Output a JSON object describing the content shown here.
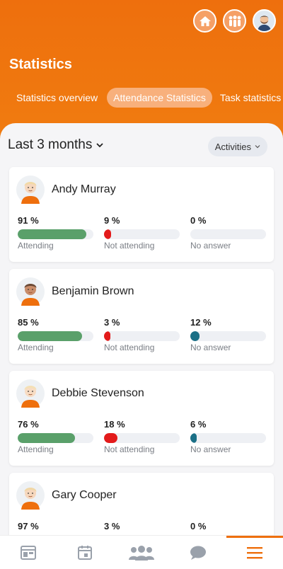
{
  "header": {
    "title": "Statistics",
    "icons": [
      "home-icon",
      "team-icon",
      "user-avatar"
    ]
  },
  "tabs": [
    {
      "label": "Statistics overview",
      "active": false
    },
    {
      "label": "Attendance Statistics",
      "active": true
    },
    {
      "label": "Task statistics",
      "active": false
    }
  ],
  "filters": {
    "period": "Last 3 months",
    "type": "Activities"
  },
  "labels": {
    "attending": "Attending",
    "not_attending": "Not attending",
    "no_answer": "No answer"
  },
  "colors": {
    "brand": "#ee6f0d",
    "attending": "#5aa06a",
    "not_attending": "#e31b1b",
    "no_answer": "#1b6f86"
  },
  "members": [
    {
      "name": "Andy Murray",
      "attending": "91 %",
      "not_attending": "9 %",
      "no_answer": "0 %",
      "values": [
        91,
        9,
        0
      ]
    },
    {
      "name": "Benjamin Brown",
      "attending": "85 %",
      "not_attending": "3 %",
      "no_answer": "12 %",
      "values": [
        85,
        3,
        12
      ]
    },
    {
      "name": "Debbie Stevenson",
      "attending": "76 %",
      "not_attending": "18 %",
      "no_answer": "6 %",
      "values": [
        76,
        18,
        6
      ]
    },
    {
      "name": "Gary Cooper",
      "attending": "97 %",
      "not_attending": "3 %",
      "no_answer": "0 %",
      "values": [
        97,
        3,
        0
      ]
    }
  ],
  "bottom_nav": [
    {
      "icon": "dashboard-icon",
      "active": false
    },
    {
      "icon": "calendar-icon",
      "active": false
    },
    {
      "icon": "group-icon",
      "active": false
    },
    {
      "icon": "chat-icon",
      "active": false
    },
    {
      "icon": "menu-icon",
      "active": true
    }
  ]
}
